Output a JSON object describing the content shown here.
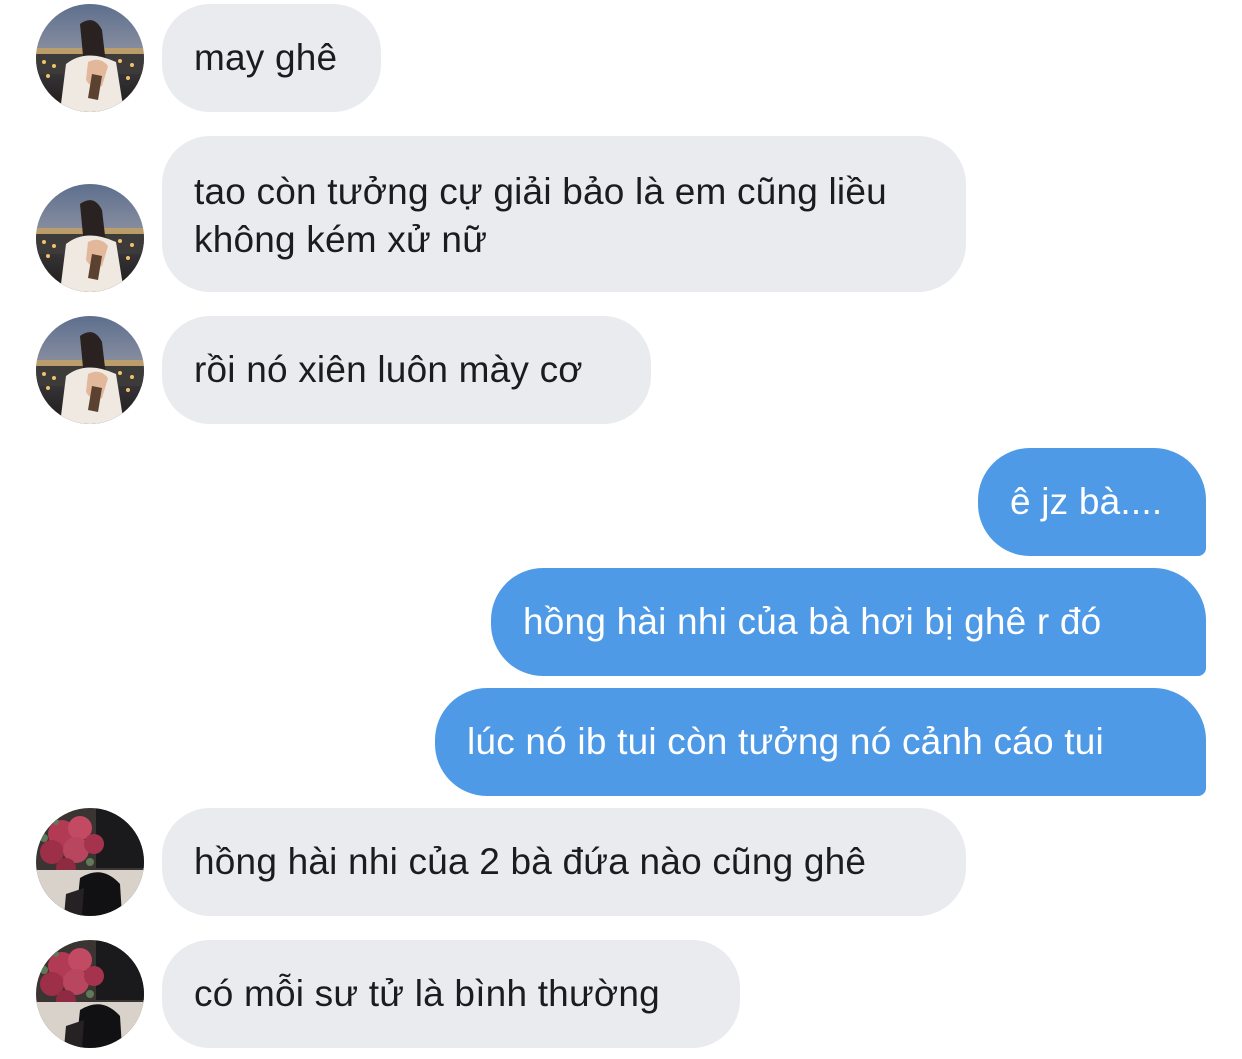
{
  "messages": [
    {
      "direction": "in",
      "avatar": "avatar-girl-city-icon",
      "text": "may ghê"
    },
    {
      "direction": "in",
      "avatar": "avatar-girl-city-icon",
      "text": "tao còn tưởng cự giải bảo là em cũng liều không kém xử nữ"
    },
    {
      "direction": "in",
      "avatar": "avatar-girl-city-icon",
      "text": "rồi nó xiên luôn mày cơ"
    },
    {
      "direction": "out",
      "text": "ê jz bà...."
    },
    {
      "direction": "out",
      "text": "hồng hài nhi của bà hơi bị ghê r đó"
    },
    {
      "direction": "out",
      "text": "lúc nó ib tui còn tưởng nó cảnh cáo tui"
    },
    {
      "direction": "in",
      "avatar": "avatar-flowers-icon",
      "text": "hồng hài nhi của 2 bà đứa nào cũng ghê"
    },
    {
      "direction": "in",
      "avatar": "avatar-flowers-icon",
      "text": "có mỗi sư tử là bình thường"
    }
  ],
  "colors": {
    "incoming_bubble": "#e9ebef",
    "outgoing_bubble": "#4f9ae6",
    "incoming_text": "#1c1c1e",
    "outgoing_text": "#ffffff"
  }
}
